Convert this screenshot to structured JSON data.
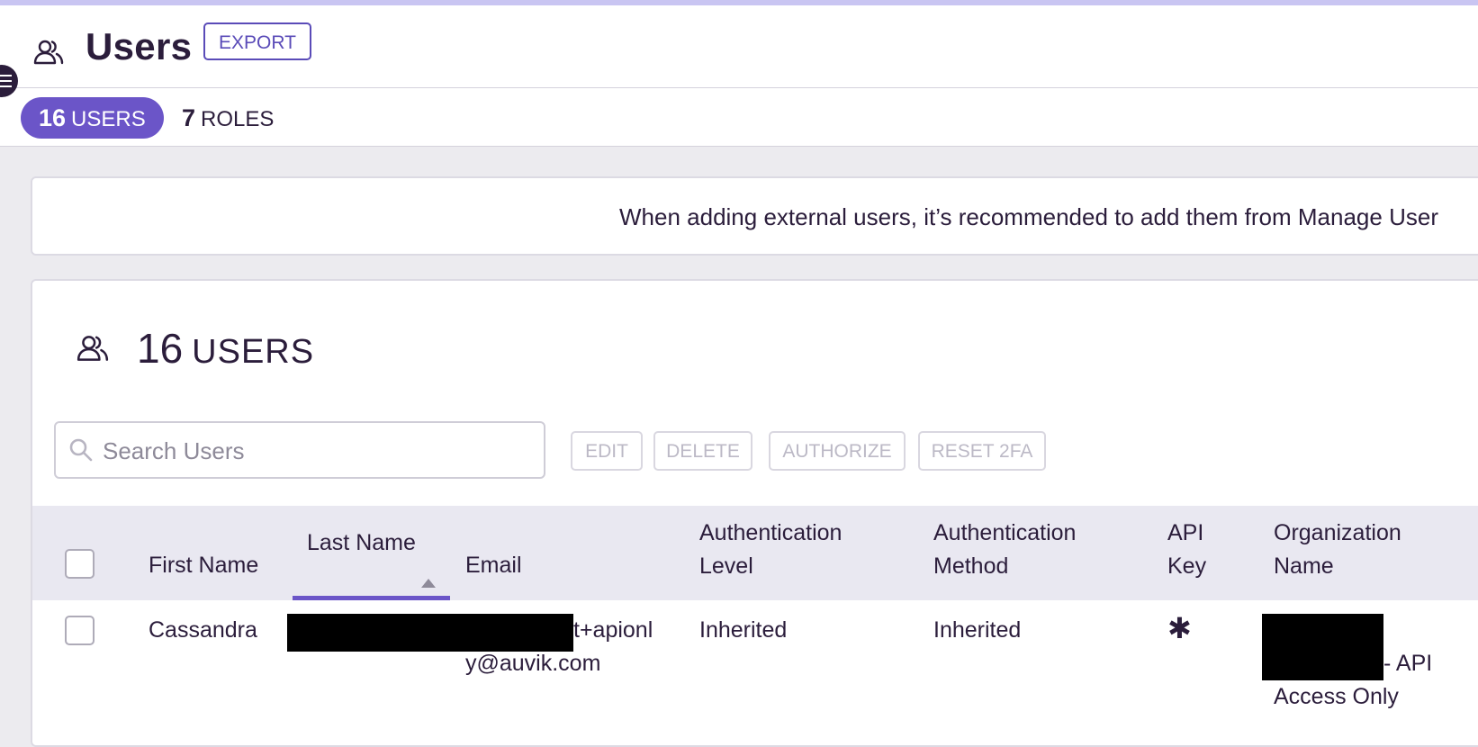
{
  "header": {
    "title": "Users",
    "export_label": "EXPORT"
  },
  "tabs": [
    {
      "count": "16",
      "label": "USERS",
      "active": true
    },
    {
      "count": "7",
      "label": "ROLES",
      "active": false
    }
  ],
  "banner": {
    "text": "When adding external users, it’s recommended to add them from Manage User"
  },
  "users_card": {
    "count": "16",
    "label": "USERS",
    "search_placeholder": "Search Users",
    "actions": {
      "edit": "EDIT",
      "delete": "DELETE",
      "authorize": "AUTHORIZE",
      "reset_2fa": "RESET 2FA"
    }
  },
  "table": {
    "columns": {
      "first_name": "First Name",
      "last_name": "Last Name",
      "email": "Email",
      "auth_level_1": "Authentication",
      "auth_level_2": "Level",
      "auth_method_1": "Authentication",
      "auth_method_2": "Method",
      "api_key_1": "API",
      "api_key_2": "Key",
      "org_name_1": "Organization",
      "org_name_2": "Name"
    },
    "rows": [
      {
        "first_name": "Cassandra",
        "email_line1": "t+apionl",
        "email_line2": "y@auvik.com",
        "auth_level": "Inherited",
        "auth_method": "Inherited",
        "api_key": "✱",
        "org_line1": "- API",
        "org_line2": "Access Only"
      }
    ]
  },
  "colors": {
    "accent": "#6b55c8",
    "text": "#2b1d3b",
    "disabled": "#bcb9c6"
  }
}
